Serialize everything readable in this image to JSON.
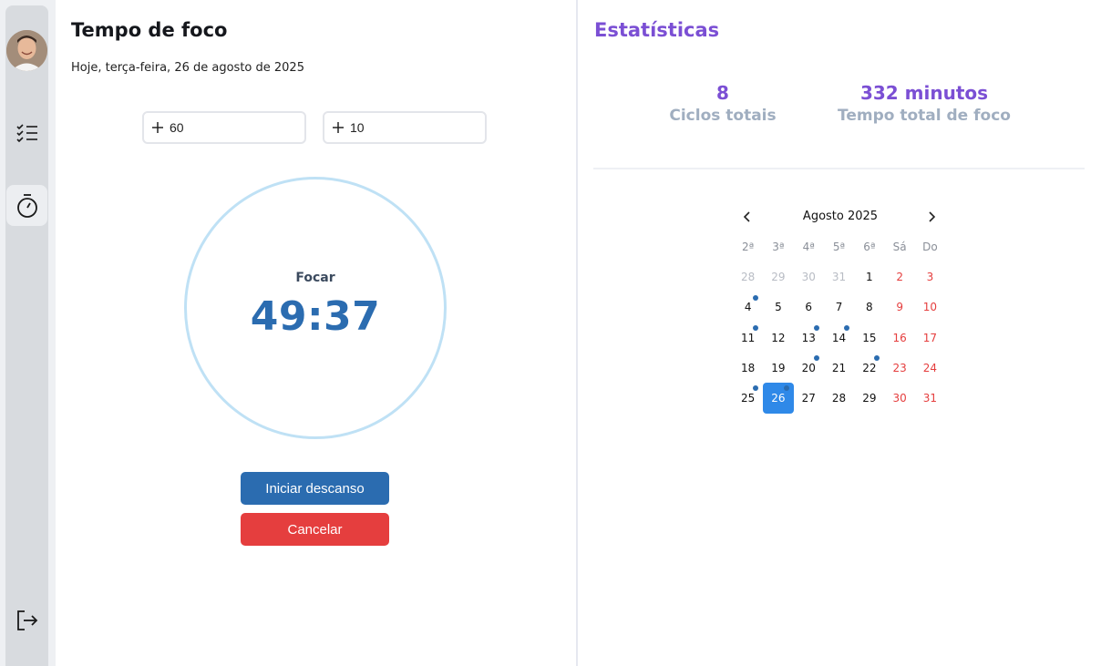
{
  "nav": {
    "avatar_icon": "user-avatar",
    "items": [
      {
        "icon": "task-list-icon",
        "active": false
      },
      {
        "icon": "stopwatch-icon",
        "active": true
      },
      {
        "icon": "logout-icon",
        "active": false
      }
    ]
  },
  "focus": {
    "title": "Tempo de foco",
    "date": "Hoje, terça-feira, 26 de agosto de 2025",
    "focus_minutes": "60",
    "break_minutes": "10",
    "timer_label": "Focar",
    "timer_value": "49:37",
    "start_break_label": "Iniciar descanso",
    "cancel_label": "Cancelar"
  },
  "stats": {
    "title": "Estatísticas",
    "cycles_value": "8",
    "cycles_label": "Ciclos totais",
    "focus_time_value": "332 minutos",
    "focus_time_label": "Tempo total de foco"
  },
  "calendar": {
    "month_label": "Agosto 2025",
    "weekdays": [
      "2ª",
      "3ª",
      "4ª",
      "5ª",
      "6ª",
      "Sá",
      "Do"
    ],
    "days": [
      {
        "d": "28",
        "outside": true
      },
      {
        "d": "29",
        "outside": true
      },
      {
        "d": "30",
        "outside": true
      },
      {
        "d": "31",
        "outside": true
      },
      {
        "d": "1"
      },
      {
        "d": "2",
        "weekend": true
      },
      {
        "d": "3",
        "weekend": true
      },
      {
        "d": "4",
        "dot": true
      },
      {
        "d": "5"
      },
      {
        "d": "6"
      },
      {
        "d": "7"
      },
      {
        "d": "8"
      },
      {
        "d": "9",
        "weekend": true
      },
      {
        "d": "10",
        "weekend": true
      },
      {
        "d": "11",
        "dot": true
      },
      {
        "d": "12"
      },
      {
        "d": "13",
        "dot": true
      },
      {
        "d": "14",
        "dot": true
      },
      {
        "d": "15"
      },
      {
        "d": "16",
        "weekend": true
      },
      {
        "d": "17",
        "weekend": true
      },
      {
        "d": "18"
      },
      {
        "d": "19"
      },
      {
        "d": "20",
        "dot": true
      },
      {
        "d": "21"
      },
      {
        "d": "22",
        "dot": true
      },
      {
        "d": "23",
        "weekend": true
      },
      {
        "d": "24",
        "weekend": true
      },
      {
        "d": "25",
        "dot": true
      },
      {
        "d": "26",
        "today": true,
        "dot": true
      },
      {
        "d": "27"
      },
      {
        "d": "28"
      },
      {
        "d": "29"
      },
      {
        "d": "30",
        "weekend": true
      },
      {
        "d": "31",
        "weekend": true
      }
    ]
  },
  "colors": {
    "primary": "#2b6cb0",
    "danger": "#e53e3e",
    "accent_purple": "#7b4fd4",
    "muted": "#a0aec0",
    "today": "#2f89e8",
    "ring": "#bfe1f5"
  }
}
